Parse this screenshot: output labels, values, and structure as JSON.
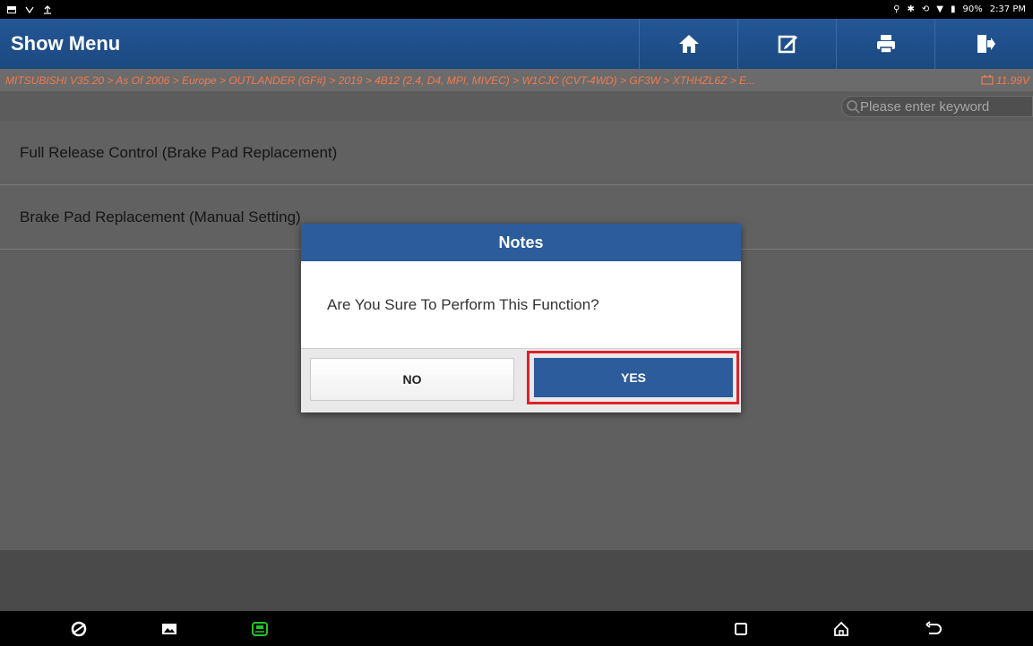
{
  "status_bar": {
    "left_icons": [
      "gallery-icon",
      "usb-icon",
      "upload-icon"
    ],
    "battery": "90%",
    "time": "2:37 PM"
  },
  "header": {
    "title": "Show Menu",
    "buttons": [
      "home-icon",
      "edit-icon",
      "print-icon",
      "exit-icon"
    ]
  },
  "breadcrumb": {
    "path": "MITSUBISHI V35.20 > As Of 2006 > Europe > OUTLANDER (GF#) > 2019 > 4B12 (2.4, D4, MPI, MIVEC) > W1CJC (CVT-4WD) > GF3W > XTHHZL6Z > E...",
    "voltage": "11.99V"
  },
  "search": {
    "placeholder": "Please enter keyword"
  },
  "menu": {
    "items": [
      {
        "label": "Full Release Control (Brake Pad Replacement)"
      },
      {
        "label": "Brake Pad Replacement (Manual Setting)"
      }
    ]
  },
  "dialog": {
    "title": "Notes",
    "message": "Are You Sure To Perform This Function?",
    "no_label": "NO",
    "yes_label": "YES"
  },
  "nav_bar": {
    "icons": [
      "browser-icon",
      "screenshot-icon",
      "vci-icon",
      "recents-icon",
      "home-icon",
      "back-icon"
    ]
  },
  "colors": {
    "header_blue": "#245796",
    "dialog_blue": "#2c5c9b",
    "breadcrumb_text": "#f07a4f",
    "highlight_red": "#e0222c"
  }
}
